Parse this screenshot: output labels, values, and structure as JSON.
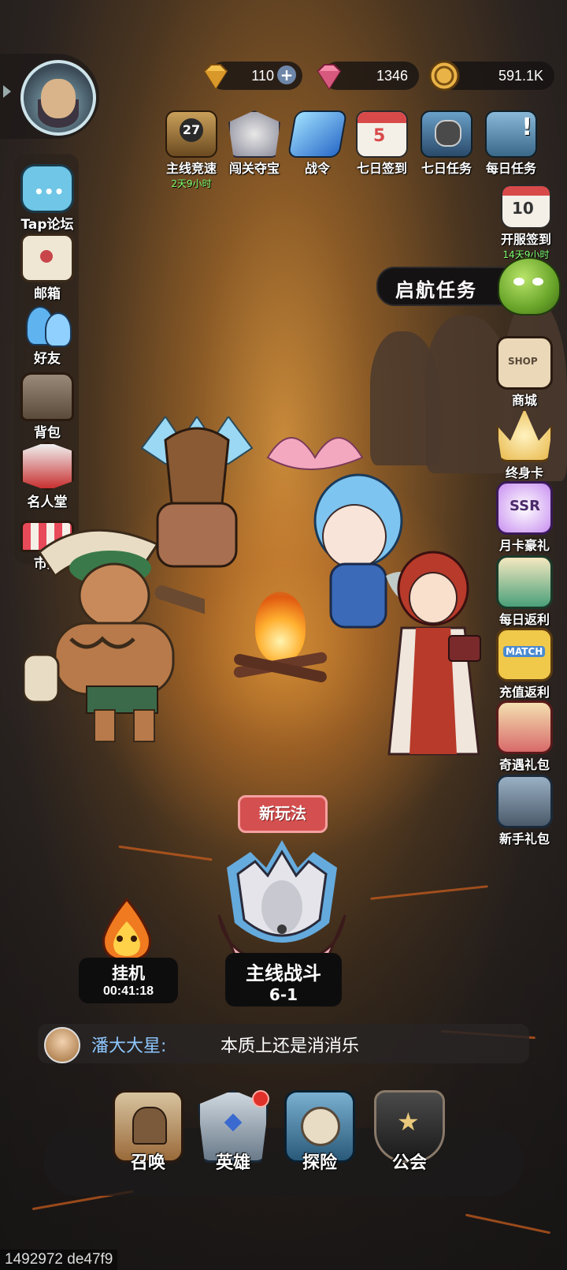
{
  "resources": [
    {
      "name": "gold-gem",
      "value": "110",
      "icon": "gold-diamond-icon",
      "color": "#f2c14e"
    },
    {
      "name": "pink-gem",
      "value": "1346",
      "icon": "pink-diamond-icon",
      "color": "#f28aa8"
    },
    {
      "name": "coin",
      "value": "591.1K",
      "icon": "coin-icon",
      "color": "#e9b347"
    }
  ],
  "top_icons": [
    {
      "label": "主线竞速",
      "sub": "2天9小时",
      "badge": "27",
      "icon": "trophy-icon"
    },
    {
      "label": "闯关夺宝",
      "icon": "wolf-emblem-icon"
    },
    {
      "label": "战令",
      "icon": "blue-flag-icon"
    },
    {
      "label": "七日签到",
      "badge": "5",
      "icon": "calendar-icon"
    },
    {
      "label": "七日任务",
      "icon": "helmet-book-icon"
    },
    {
      "label": "每日任务",
      "icon": "quest-book-icon"
    }
  ],
  "server_signin": {
    "label": "开服签到",
    "badge": "10",
    "sub": "14天9小时"
  },
  "quest_banner": {
    "label": "启航任务"
  },
  "left_menu": [
    {
      "label": "Tap论坛",
      "icon": "chat-bubble-icon"
    },
    {
      "label": "邮箱",
      "icon": "mail-icon"
    },
    {
      "label": "好友",
      "icon": "friends-icon"
    },
    {
      "label": "背包",
      "icon": "backpack-icon"
    },
    {
      "label": "名人堂",
      "icon": "hall-of-fame-icon"
    },
    {
      "label": "市集",
      "icon": "market-stall-icon"
    }
  ],
  "right_menu": [
    {
      "label": "商城",
      "icon": "shop-bag-icon",
      "tag": "SHOP"
    },
    {
      "label": "终身卡",
      "icon": "crown-icon"
    },
    {
      "label": "月卡豪礼",
      "icon": "ssr-card-icon",
      "tag": "SSR"
    },
    {
      "label": "每日返利",
      "icon": "gift-box-icon"
    },
    {
      "label": "充值返利",
      "icon": "match-card-icon",
      "tag": "MATCH"
    },
    {
      "label": "奇遇礼包",
      "icon": "gift-basket-icon"
    },
    {
      "label": "新手礼包",
      "icon": "starter-pack-icon"
    }
  ],
  "main_battle": {
    "tag": "新玩法",
    "title": "主线战斗",
    "stage": "6-1"
  },
  "idle": {
    "title": "挂机",
    "timer": "00:41:18"
  },
  "chat": {
    "name": "潘大大星:",
    "message": "本质上还是消消乐"
  },
  "bottom_nav": [
    {
      "label": "召唤",
      "icon": "summon-icon"
    },
    {
      "label": "英雄",
      "icon": "hero-icon",
      "has_dot": true
    },
    {
      "label": "探险",
      "icon": "compass-icon"
    },
    {
      "label": "公会",
      "icon": "guild-shield-icon"
    }
  ],
  "build_id": "1492972 de47f9"
}
